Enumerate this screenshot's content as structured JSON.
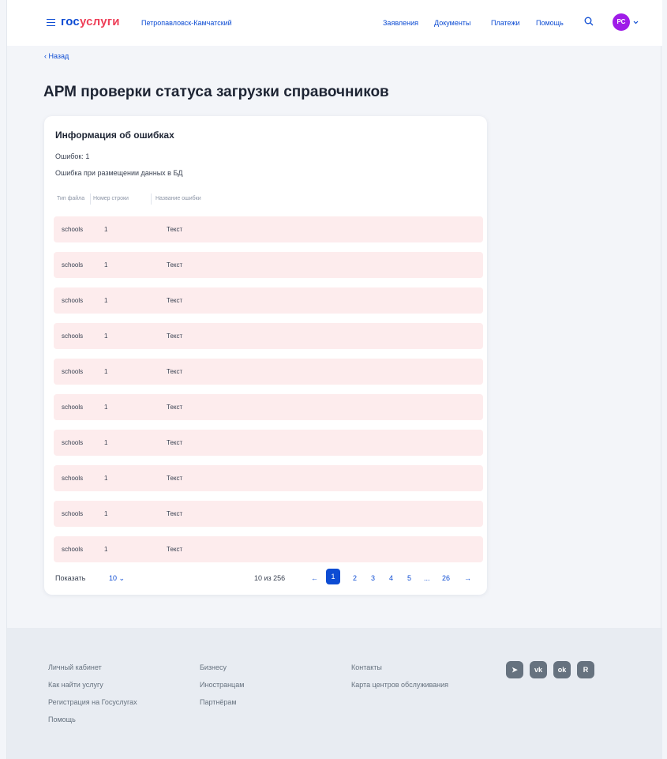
{
  "header": {
    "logo_part1": "гос",
    "logo_part2": "услуги",
    "region": "Петропавловск-Камчатский",
    "nav": [
      "Заявления",
      "Документы",
      "Платежи",
      "Помощь"
    ],
    "avatar_initials": "РС"
  },
  "back_label": "‹ Назад",
  "page_title": "АРМ проверки статуса загрузки справочников",
  "card": {
    "title": "Информация об ошибках",
    "error_count": "Ошибок: 1",
    "error_description": "Ошибка при размещении данных в БД",
    "columns": [
      "Тип файла",
      "Номер строки",
      "Название ошибки"
    ],
    "rows": [
      {
        "file_type": "schools",
        "line": "1",
        "error": "Текст"
      },
      {
        "file_type": "schools",
        "line": "1",
        "error": "Текст"
      },
      {
        "file_type": "schools",
        "line": "1",
        "error": "Текст"
      },
      {
        "file_type": "schools",
        "line": "1",
        "error": "Текст"
      },
      {
        "file_type": "schools",
        "line": "1",
        "error": "Текст"
      },
      {
        "file_type": "schools",
        "line": "1",
        "error": "Текст"
      },
      {
        "file_type": "schools",
        "line": "1",
        "error": "Текст"
      },
      {
        "file_type": "schools",
        "line": "1",
        "error": "Текст"
      },
      {
        "file_type": "schools",
        "line": "1",
        "error": "Текст"
      },
      {
        "file_type": "schools",
        "line": "1",
        "error": "Текст"
      }
    ]
  },
  "pagination": {
    "show_label": "Показать",
    "per_page": "10 ⌄",
    "range": "10 из 256",
    "prev": "←",
    "pages": [
      "1",
      "2",
      "3",
      "4",
      "5"
    ],
    "ellipsis": "...",
    "last": "26",
    "next": "→",
    "active_page": "1"
  },
  "footer": {
    "col1": [
      "Личный кабинет",
      "Как найти услугу",
      "Регистрация на Госуслугах",
      "Помощь"
    ],
    "col2": [
      "Бизнесу",
      "Иностранцам",
      "Партнёрам"
    ],
    "col3": [
      "Контакты",
      "Карта центров обслуживания"
    ],
    "social": [
      {
        "icon": "telegram-icon",
        "label": "➤"
      },
      {
        "icon": "vk-icon",
        "label": "vk"
      },
      {
        "icon": "odnoklassniki-icon",
        "label": "ok"
      },
      {
        "icon": "rutube-icon",
        "label": "R"
      }
    ]
  },
  "colors": {
    "brand_blue": "#0d4cd3",
    "brand_red": "#ee3f58",
    "error_row": "#fdeced",
    "avatar": "#9f1ce8"
  }
}
